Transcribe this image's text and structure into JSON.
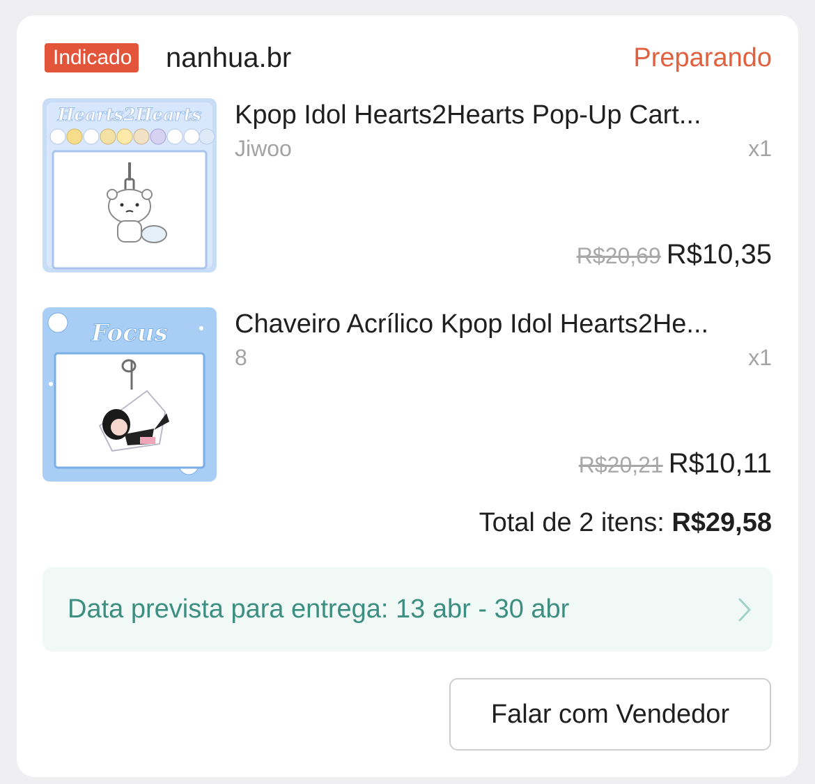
{
  "order": {
    "badge": "Indicado",
    "shop_name": "nanhua.br",
    "status": "Preparando",
    "items": [
      {
        "title": "Kpop Idol Hearts2Hearts Pop-Up Cart...",
        "variant": "Jiwoo",
        "qty": "x1",
        "price_old": "R$20,69",
        "price_new": "R$10,35",
        "thumb_text": "Hearts2Hearts"
      },
      {
        "title": "Chaveiro Acrílico Kpop Idol Hearts2He...",
        "variant": "8",
        "qty": "x1",
        "price_old": "R$20,21",
        "price_new": "R$10,11",
        "thumb_text": "Focus"
      }
    ],
    "total_label": "Total de 2 itens: ",
    "total_value": "R$29,58",
    "delivery_text": "Data prevista para entrega: 13 abr - 30 abr",
    "chat_button": "Falar com Vendedor"
  },
  "colors": {
    "badge_bg": "#e2553a",
    "status": "#e0603f",
    "delivery_text": "#3c8f80",
    "delivery_bg": "#f1f9f7"
  },
  "icons": [
    "chevron-right-icon"
  ]
}
